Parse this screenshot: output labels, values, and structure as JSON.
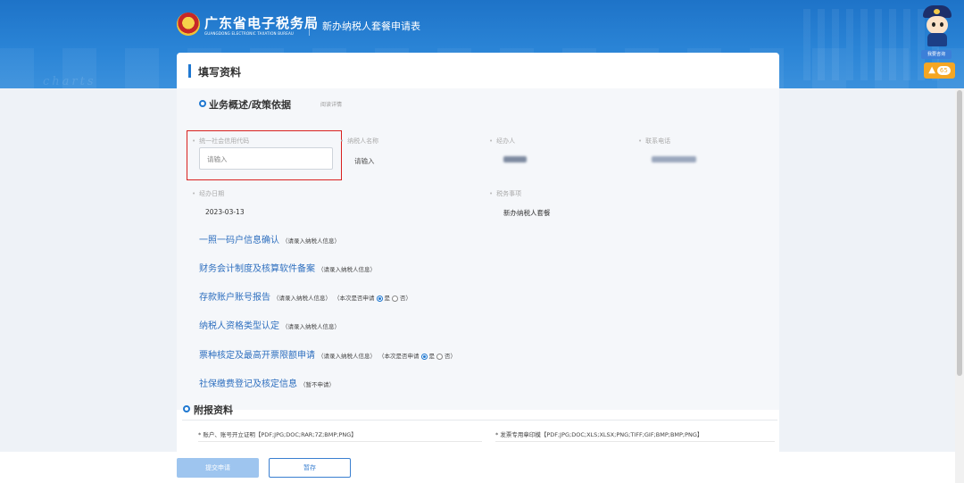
{
  "header": {
    "brand_title": "广东省电子税务局",
    "brand_subtitle": "GUANGDONG ELECTRONIC TAXATION BUREAU",
    "page_name": "新办纳税人套餐申请表",
    "consult_label": "我要咨询",
    "alert_count": "65",
    "alert_icon": "warning-icon",
    "logo_icon": "tax-emblem-icon",
    "mascot_icon": "tax-officer-mascot-icon"
  },
  "form": {
    "section_title": "填写资料",
    "business": {
      "title": "业务概述/政策依据",
      "link": "阅读详情"
    },
    "fields": {
      "credit_code": {
        "label": "统一社会信用代码",
        "placeholder": "请输入",
        "value": ""
      },
      "taxpayer_name": {
        "label": "纳税人名称",
        "value": "请输入"
      },
      "agent": {
        "label": "经办人"
      },
      "phone": {
        "label": "联系电话"
      },
      "date": {
        "label": "经办日期",
        "value": "2023-03-13"
      },
      "tax_matter": {
        "label": "税务事项",
        "value": "新办纳税人套餐"
      }
    },
    "sub_items": [
      {
        "name": "一照一码户信息确认",
        "note": "（请录入纳税人信息）"
      },
      {
        "name": "财务会计制度及核算软件备案",
        "note": "（请录入纳税人信息）"
      },
      {
        "name": "存款账户账号报告",
        "note": "（请录入纳税人信息）",
        "apply_text": "（本次是否申请",
        "yes": "是",
        "no": "否）",
        "selected": "是"
      },
      {
        "name": "纳税人资格类型认定",
        "note": "（请录入纳税人信息）"
      },
      {
        "name": "票种核定及最高开票限额申请",
        "note": "（请录入纳税人信息）",
        "apply_text": "（本次是否申请",
        "yes": "是",
        "no": "否）",
        "selected": "是"
      },
      {
        "name": "社保缴费登记及核定信息",
        "note": "（暂不申请）"
      }
    ]
  },
  "attachments": {
    "title": "附报资料",
    "items": [
      {
        "label": "* 账户、账号开立证明【PDF;JPG;DOC;RAR;7Z;BMP;PNG】"
      },
      {
        "label": "* 发票专用章印模【PDF;JPG;DOC;XLS;XLSX;PNG;TIFF;GIF;BMP;BMP;PNG】"
      }
    ]
  },
  "footer": {
    "submit_label": "提交申请",
    "save_label": "暂存"
  },
  "colors": {
    "brand_blue": "#1f78d1",
    "highlight_red": "#d9201e",
    "link_blue": "#2e6fbf",
    "alert_orange": "#f5a623"
  }
}
